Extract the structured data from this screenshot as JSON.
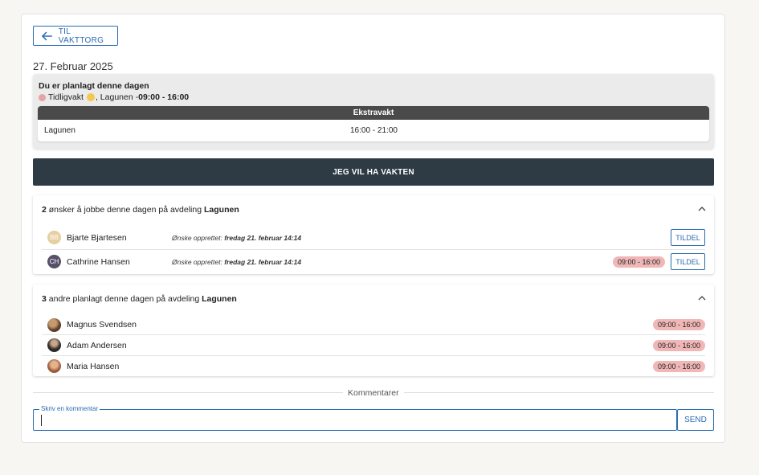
{
  "back_button": {
    "label": "TIL VAKTTORG"
  },
  "date": "27. Februar 2025",
  "planned": {
    "title": "Du er planlagt denne dagen",
    "shift_name": "Tidligvakt",
    "shift_dept": ", Lagunen - ",
    "shift_time": "09:00 - 16:00",
    "dot_color": "#e6a3a3"
  },
  "extra_shift": {
    "header": "Ekstravakt",
    "department": "Lagunen",
    "time": "16:00 - 21:00"
  },
  "claim_button": {
    "label": "JEG VIL HA VAKTEN"
  },
  "wishes": {
    "count": "2",
    "text": " ønsker å jobbe denne dagen på avdeling ",
    "department": "Lagunen",
    "assign_label": "TILDEL",
    "wish_prefix": "Ønske opprettet: ",
    "rows": [
      {
        "initials": "BB",
        "name": "Bjarte Bjartesen",
        "created": "fredag 21. februar 14:14",
        "shift": ""
      },
      {
        "initials": "CH",
        "name": "Cathrine Hansen",
        "created": "fredag 21. februar 14:14",
        "shift": "09:00 - 16:00"
      }
    ]
  },
  "others": {
    "count": "3",
    "text": " andre planlagt denne dagen på avdeling ",
    "department": "Lagunen",
    "rows": [
      {
        "name": "Magnus Svendsen",
        "shift": "09:00 - 16:00"
      },
      {
        "name": "Adam Andersen",
        "shift": "09:00 - 16:00"
      },
      {
        "name": "Maria Hansen",
        "shift": "09:00 - 16:00"
      }
    ]
  },
  "comments": {
    "divider_label": "Kommentarer",
    "input_legend": "Skriv en kommentar",
    "input_value": "",
    "send_label": "SEND"
  },
  "colors": {
    "accent": "#2b6cb0",
    "dark_button": "#2e3a44",
    "shift_pill": "#f1b7b7"
  }
}
